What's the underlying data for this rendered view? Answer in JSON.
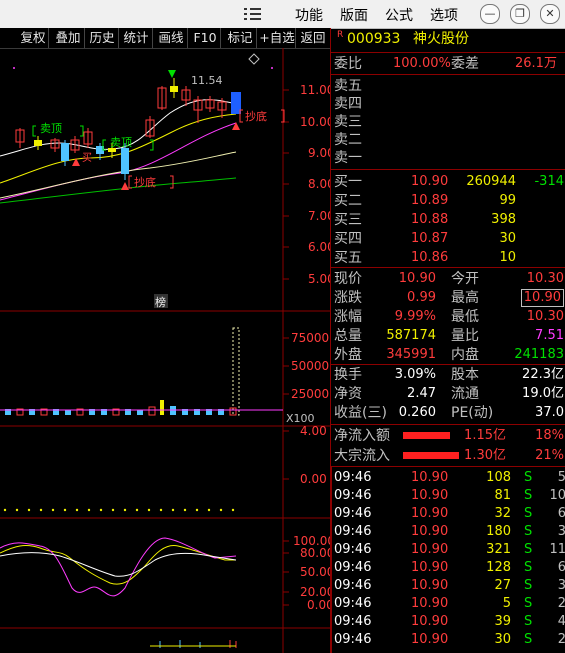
{
  "menu": {
    "icon": "menu-icon",
    "items": [
      "功能",
      "版面",
      "公式",
      "选项"
    ]
  },
  "window_controls": [
    "minimize-icon",
    "restore-icon",
    "close-icon"
  ],
  "toolbar": [
    "复权",
    "叠加",
    "历史",
    "统计",
    "画线",
    "F10",
    "标记",
    "+自选",
    "返回"
  ],
  "kline_panel": {
    "y_ticks": [
      "11.00",
      "10.00",
      "9.00",
      "8.00",
      "7.00",
      "6.00",
      "5.00"
    ],
    "annotations": [
      "卖顶",
      "买",
      "卖顶",
      "抄底",
      "抄底",
      "11.54"
    ],
    "badge": "榜",
    "diamond_icon": "diamond-icon"
  },
  "volume_panel": {
    "y_ticks": [
      "75000",
      "50000",
      "25000"
    ],
    "unit": "X100"
  },
  "macd_panel": {
    "y_ticks": [
      "4.00",
      "0.00"
    ]
  },
  "kdj_panel": {
    "y_ticks": [
      "100.00",
      "80.00",
      "50.00",
      "20.00",
      "0.00"
    ]
  },
  "stock": {
    "marker": "R",
    "code": "000933",
    "name": "神火股份"
  },
  "order_ratio": {
    "label": "委比",
    "value": "100.00%",
    "diff_label": "委差",
    "diff": "26.1万"
  },
  "sell_levels": [
    {
      "label": "卖五",
      "price": "",
      "qty": "",
      "chg": ""
    },
    {
      "label": "卖四",
      "price": "",
      "qty": "",
      "chg": ""
    },
    {
      "label": "卖三",
      "price": "",
      "qty": "",
      "chg": ""
    },
    {
      "label": "卖二",
      "price": "",
      "qty": "",
      "chg": ""
    },
    {
      "label": "卖一",
      "price": "",
      "qty": "",
      "chg": ""
    }
  ],
  "buy_levels": [
    {
      "label": "买一",
      "price": "10.90",
      "qty": "260944",
      "chg": "-314"
    },
    {
      "label": "买二",
      "price": "10.89",
      "qty": "99",
      "chg": ""
    },
    {
      "label": "买三",
      "price": "10.88",
      "qty": "398",
      "chg": ""
    },
    {
      "label": "买四",
      "price": "10.87",
      "qty": "30",
      "chg": ""
    },
    {
      "label": "买五",
      "price": "10.86",
      "qty": "10",
      "chg": ""
    }
  ],
  "quote": [
    {
      "l1": "现价",
      "v1": "10.90",
      "l2": "今开",
      "v2": "10.30",
      "c1": "red",
      "c2": "red",
      "box": false
    },
    {
      "l1": "涨跌",
      "v1": "0.99",
      "l2": "最高",
      "v2": "10.90",
      "c1": "red",
      "c2": "red",
      "box": true
    },
    {
      "l1": "涨幅",
      "v1": "9.99%",
      "l2": "最低",
      "v2": "10.30",
      "c1": "red",
      "c2": "red",
      "box": false
    },
    {
      "l1": "总量",
      "v1": "587174",
      "l2": "量比",
      "v2": "7.51",
      "c1": "yellow",
      "c2": "magenta",
      "box": false
    },
    {
      "l1": "外盘",
      "v1": "345991",
      "l2": "内盘",
      "v2": "241183",
      "c1": "red",
      "c2": "green",
      "box": false
    }
  ],
  "quote2": [
    {
      "l1": "换手",
      "v1": "3.09%",
      "l2": "股本",
      "v2": "22.3亿"
    },
    {
      "l1": "净资",
      "v1": "2.47",
      "l2": "流通",
      "v2": "19.0亿"
    },
    {
      "l1": "收益(三)",
      "v1": "0.260",
      "l2": "PE(动)",
      "v2": "37.0"
    }
  ],
  "flows": [
    {
      "label": "净流入额",
      "amount": "1.15亿",
      "pct": "18%",
      "bar": 0.84
    },
    {
      "label": "大宗流入",
      "amount": "1.30亿",
      "pct": "21%",
      "bar": 1.0
    }
  ],
  "ticks": [
    {
      "time": "09:46",
      "price": "10.90",
      "vol": "108",
      "side": "S",
      "n": "5"
    },
    {
      "time": "09:46",
      "price": "10.90",
      "vol": "81",
      "side": "S",
      "n": "10"
    },
    {
      "time": "09:46",
      "price": "10.90",
      "vol": "32",
      "side": "S",
      "n": "6"
    },
    {
      "time": "09:46",
      "price": "10.90",
      "vol": "180",
      "side": "S",
      "n": "3"
    },
    {
      "time": "09:46",
      "price": "10.90",
      "vol": "321",
      "side": "S",
      "n": "11"
    },
    {
      "time": "09:46",
      "price": "10.90",
      "vol": "128",
      "side": "S",
      "n": "6"
    },
    {
      "time": "09:46",
      "price": "10.90",
      "vol": "27",
      "side": "S",
      "n": "3"
    },
    {
      "time": "09:46",
      "price": "10.90",
      "vol": "5",
      "side": "S",
      "n": "2"
    },
    {
      "time": "09:46",
      "price": "10.90",
      "vol": "39",
      "side": "S",
      "n": "4"
    },
    {
      "time": "09:46",
      "price": "10.90",
      "vol": "30",
      "side": "S",
      "n": "2"
    }
  ]
}
